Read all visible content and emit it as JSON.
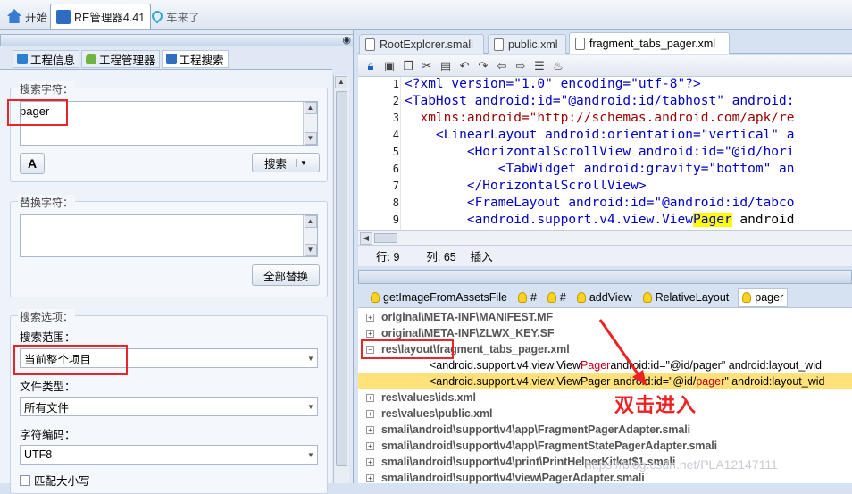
{
  "top_tabs": [
    {
      "label": "开始",
      "icon": "home-icon"
    },
    {
      "label": "RE管理器4.41",
      "icon": "re-manager-icon"
    },
    {
      "label": "车来了",
      "icon": "location-pin-icon"
    }
  ],
  "left_tabs": [
    {
      "label": "工程信息",
      "icon": "info-icon"
    },
    {
      "label": "工程管理器",
      "icon": "android-icon"
    },
    {
      "label": "工程搜索",
      "icon": "search-icon"
    }
  ],
  "search": {
    "group_label": "搜索字符：",
    "value": "pager",
    "button_label": "搜索"
  },
  "replace": {
    "group_label": "替换字符：",
    "value": "",
    "button_label": "全部替换"
  },
  "options": {
    "group_label": "搜索选项：",
    "scope_label": "搜索范围：",
    "scope_value": "当前整个项目",
    "filetype_label": "文件类型：",
    "filetype_value": "所有文件",
    "encoding_label": "字符编码：",
    "encoding_value": "UTF8",
    "case_label": "匹配大小写"
  },
  "file_tabs": [
    "RootExplorer.smali",
    "public.xml",
    "fragment_tabs_pager.xml"
  ],
  "editor_lines": [
    {
      "n": "1",
      "code": "<?xml version=\"1.0\" encoding=\"utf-8\"?>"
    },
    {
      "n": "2",
      "code": "<TabHost android:id=\"@android:id/tabhost\" android:"
    },
    {
      "n": "3",
      "code": "  xmlns:android=\"http://schemas.android.com/apk/re"
    },
    {
      "n": "4",
      "code": "    <LinearLayout android:orientation=\"vertical\" a"
    },
    {
      "n": "5",
      "code": "        <HorizontalScrollView android:id=\"@id/hori"
    },
    {
      "n": "6",
      "code": "            <TabWidget android:gravity=\"bottom\" an"
    },
    {
      "n": "7",
      "code": "        </HorizontalScrollView>"
    },
    {
      "n": "8",
      "code": "        <FrameLayout android:id=\"@android:id/tabco"
    },
    {
      "n": "9a",
      "code": "        <android.support.v4.view.View"
    },
    {
      "n": "9b",
      "code": "Pager"
    },
    {
      "n": "9c",
      "code": " android"
    }
  ],
  "status": {
    "row": "行: 9",
    "col": "列: 65",
    "mode": "插入"
  },
  "result_tabs": [
    "getImageFromAssetsFile",
    "#",
    "#",
    "addView",
    "RelativeLayout",
    "pager"
  ],
  "results": [
    {
      "text": "original\\META-INF\\MANIFEST.MF"
    },
    {
      "text": "original\\META-INF\\ZLWX_KEY.SF"
    },
    {
      "text": "res\\layout\\fragment_tabs_pager.xml"
    },
    {
      "pre": "<android.support.v4.view.View",
      "match": "Pager",
      "post": " android:id=\"@id/pager\" android:layout_wid"
    },
    {
      "pre": "<android.support.v4.view.ViewPager android:id=\"@id/",
      "match": "pager",
      "post": "\" android:layout_wid"
    },
    {
      "text": "res\\values\\ids.xml"
    },
    {
      "text": "res\\values\\public.xml"
    },
    {
      "text": "smali\\android\\support\\v4\\app\\FragmentPagerAdapter.smali"
    },
    {
      "text": "smali\\android\\support\\v4\\app\\FragmentStatePagerAdapter.smali"
    },
    {
      "text": "smali\\android\\support\\v4\\print\\PrintHelperKitkat$1.smali"
    },
    {
      "text": "smali\\android\\support\\v4\\view\\PagerAdapter.smali"
    }
  ],
  "annotation": "双击进入",
  "watermark": "https://blog.csdn.net/PLA12147111",
  "colors": {
    "highlight_row": "#ffe27a",
    "red_box": "#e8262a",
    "code_blue": "#0000c8",
    "code_value": "#9b0000"
  }
}
